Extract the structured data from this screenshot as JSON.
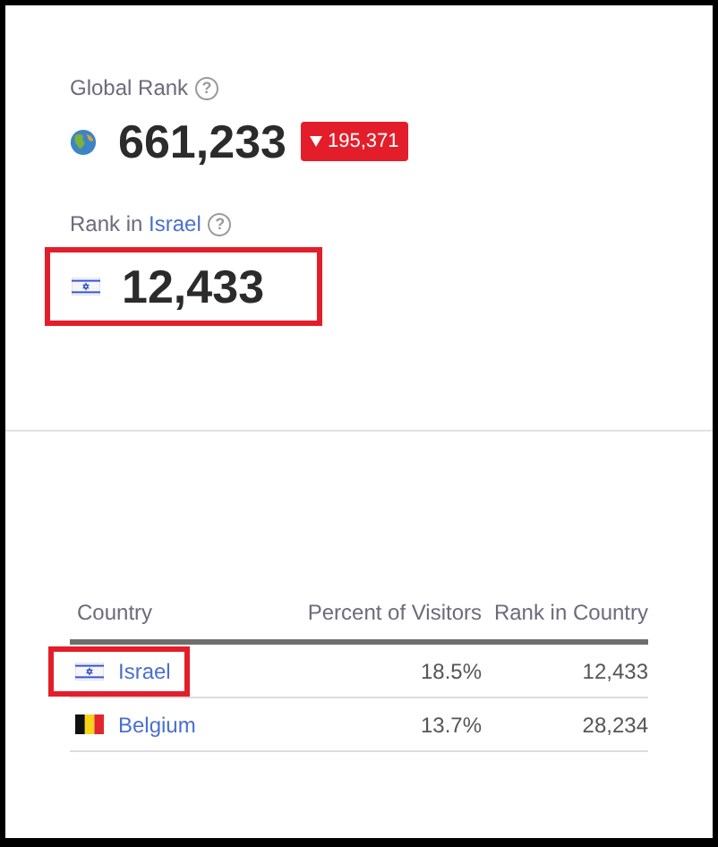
{
  "global_rank": {
    "label": "Global Rank",
    "help": "?",
    "value": "661,233",
    "change": {
      "kind": "down",
      "text": "195,371"
    }
  },
  "country_rank": {
    "label": "Rank in ",
    "country": "Israel",
    "help": "?",
    "kind": "il",
    "value": "12,433",
    "highlighted": true
  },
  "table": {
    "columns": [
      "Country",
      "Percent of Visitors",
      "Rank in Country"
    ],
    "rows": [
      {
        "kind": "il",
        "country": "Israel",
        "percent": "18.5%",
        "rank": "12,433",
        "highlighted": true
      },
      {
        "kind": "be",
        "country": "Belgium",
        "percent": "13.7%",
        "rank": "28,234",
        "highlighted": false
      }
    ]
  }
}
